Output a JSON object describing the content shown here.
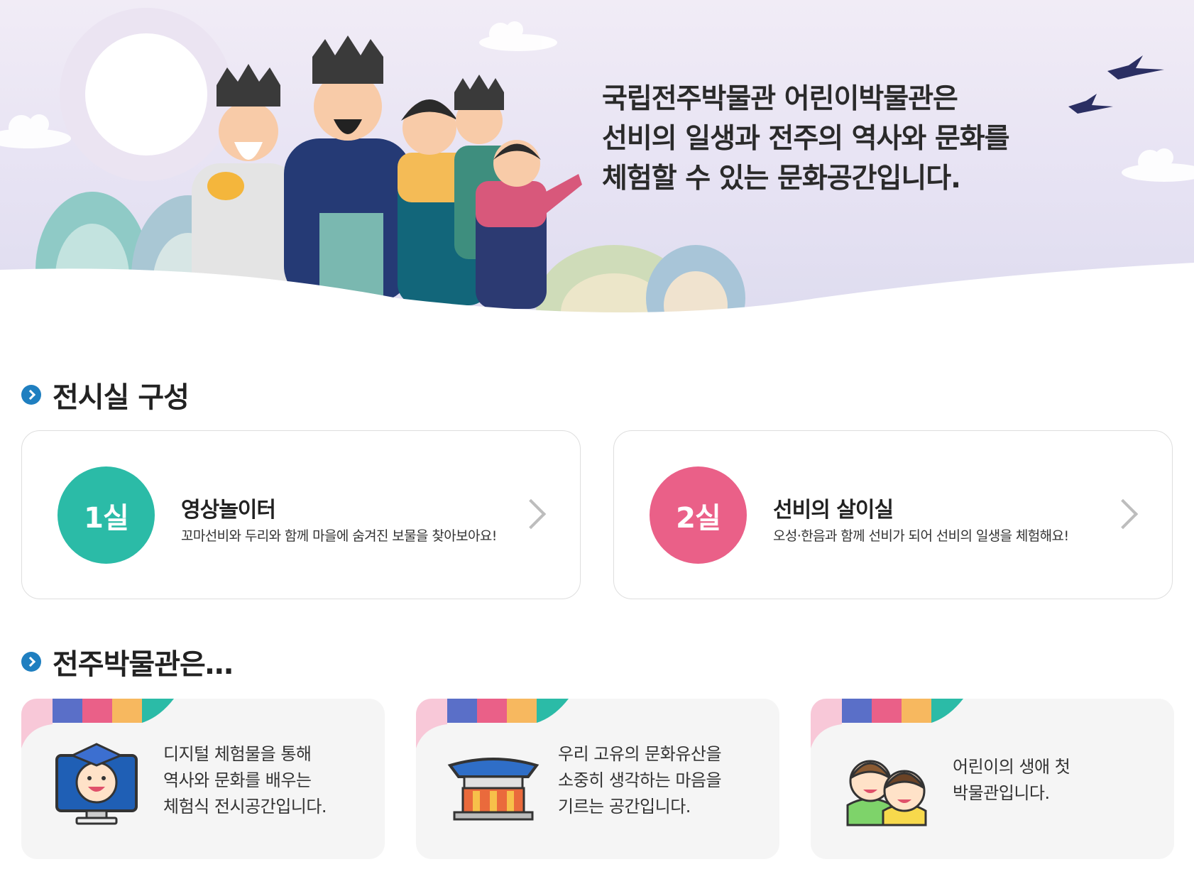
{
  "hero": {
    "lines": [
      "국립전주박물관 어린이박물관은",
      "선비의 일생과 전주의 역사와 문화를",
      "체험할 수 있는 문화공간입니다."
    ]
  },
  "sections": {
    "rooms_title": "전시실 구성",
    "about_title": "전주박물관은…"
  },
  "rooms": [
    {
      "badge": "1실",
      "name": "영상놀이터",
      "desc": "꼬마선비와 두리와 함께 마을에 숨겨진 보물을 찾아보아요!",
      "color": "#2bbba7"
    },
    {
      "badge": "2실",
      "name": "선비의 살이실",
      "desc": "오성·한음과 함께 선비가 되어 선비의 일생을 체험해요!",
      "color": "#ea6088"
    }
  ],
  "about": [
    {
      "icon": "graduation-kid-monitor-icon",
      "lines": [
        "디지털 체험물을 통해",
        "역사와 문화를 배우는",
        "체험식 전시공간입니다."
      ]
    },
    {
      "icon": "traditional-building-icon",
      "lines": [
        "우리 고유의 문화유산을",
        "소중히 생각하는 마음을",
        "기르는 공간입니다."
      ]
    },
    {
      "icon": "two-children-icon",
      "lines": [
        "어린이의 생애 첫",
        "박물관입니다."
      ]
    }
  ],
  "colors": {
    "stripe": [
      "#f8c8d8",
      "#5a6fc8",
      "#ea6088",
      "#f7b85f",
      "#2bbba7"
    ],
    "heading_dot": "#1f7fc0"
  }
}
